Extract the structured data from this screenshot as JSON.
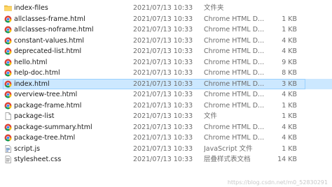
{
  "files": [
    {
      "name": "index-files",
      "date": "2021/07/13 10:33",
      "type": "文件夹",
      "size": "",
      "icon": "folder-icon",
      "selected": false
    },
    {
      "name": "allclasses-frame.html",
      "date": "2021/07/13 10:33",
      "type": "Chrome HTML D...",
      "size": "1 KB",
      "icon": "chrome-icon",
      "selected": false
    },
    {
      "name": "allclasses-noframe.html",
      "date": "2021/07/13 10:33",
      "type": "Chrome HTML D...",
      "size": "1 KB",
      "icon": "chrome-icon",
      "selected": false
    },
    {
      "name": "constant-values.html",
      "date": "2021/07/13 10:33",
      "type": "Chrome HTML D...",
      "size": "4 KB",
      "icon": "chrome-icon",
      "selected": false
    },
    {
      "name": "deprecated-list.html",
      "date": "2021/07/13 10:33",
      "type": "Chrome HTML D...",
      "size": "4 KB",
      "icon": "chrome-icon",
      "selected": false
    },
    {
      "name": "hello.html",
      "date": "2021/07/13 10:33",
      "type": "Chrome HTML D...",
      "size": "9 KB",
      "icon": "chrome-icon",
      "selected": false
    },
    {
      "name": "help-doc.html",
      "date": "2021/07/13 10:33",
      "type": "Chrome HTML D...",
      "size": "8 KB",
      "icon": "chrome-icon",
      "selected": false
    },
    {
      "name": "index.html",
      "date": "2021/07/13 10:33",
      "type": "Chrome HTML D...",
      "size": "3 KB",
      "icon": "chrome-icon",
      "selected": true
    },
    {
      "name": "overview-tree.html",
      "date": "2021/07/13 10:33",
      "type": "Chrome HTML D...",
      "size": "4 KB",
      "icon": "chrome-icon",
      "selected": false
    },
    {
      "name": "package-frame.html",
      "date": "2021/07/13 10:33",
      "type": "Chrome HTML D...",
      "size": "1 KB",
      "icon": "chrome-icon",
      "selected": false
    },
    {
      "name": "package-list",
      "date": "2021/07/13 10:33",
      "type": "文件",
      "size": "1 KB",
      "icon": "file-icon",
      "selected": false
    },
    {
      "name": "package-summary.html",
      "date": "2021/07/13 10:33",
      "type": "Chrome HTML D...",
      "size": "4 KB",
      "icon": "chrome-icon",
      "selected": false
    },
    {
      "name": "package-tree.html",
      "date": "2021/07/13 10:33",
      "type": "Chrome HTML D...",
      "size": "4 KB",
      "icon": "chrome-icon",
      "selected": false
    },
    {
      "name": "script.js",
      "date": "2021/07/13 10:33",
      "type": "JavaScript 文件",
      "size": "1 KB",
      "icon": "script-file-icon",
      "selected": false
    },
    {
      "name": "stylesheet.css",
      "date": "2021/07/13 10:33",
      "type": "层叠样式表文档",
      "size": "14 KB",
      "icon": "css-file-icon",
      "selected": false
    }
  ],
  "watermark": "https://blog.csdn.net/m0_52830291",
  "colors": {
    "selection_bg": "#cce8ff",
    "selection_border": "#99d1ff",
    "folder": "#f3c74e",
    "chrome_red": "#db4437",
    "chrome_yellow": "#f4c20d",
    "chrome_green": "#0f9d58",
    "chrome_blue": "#4285f4"
  }
}
